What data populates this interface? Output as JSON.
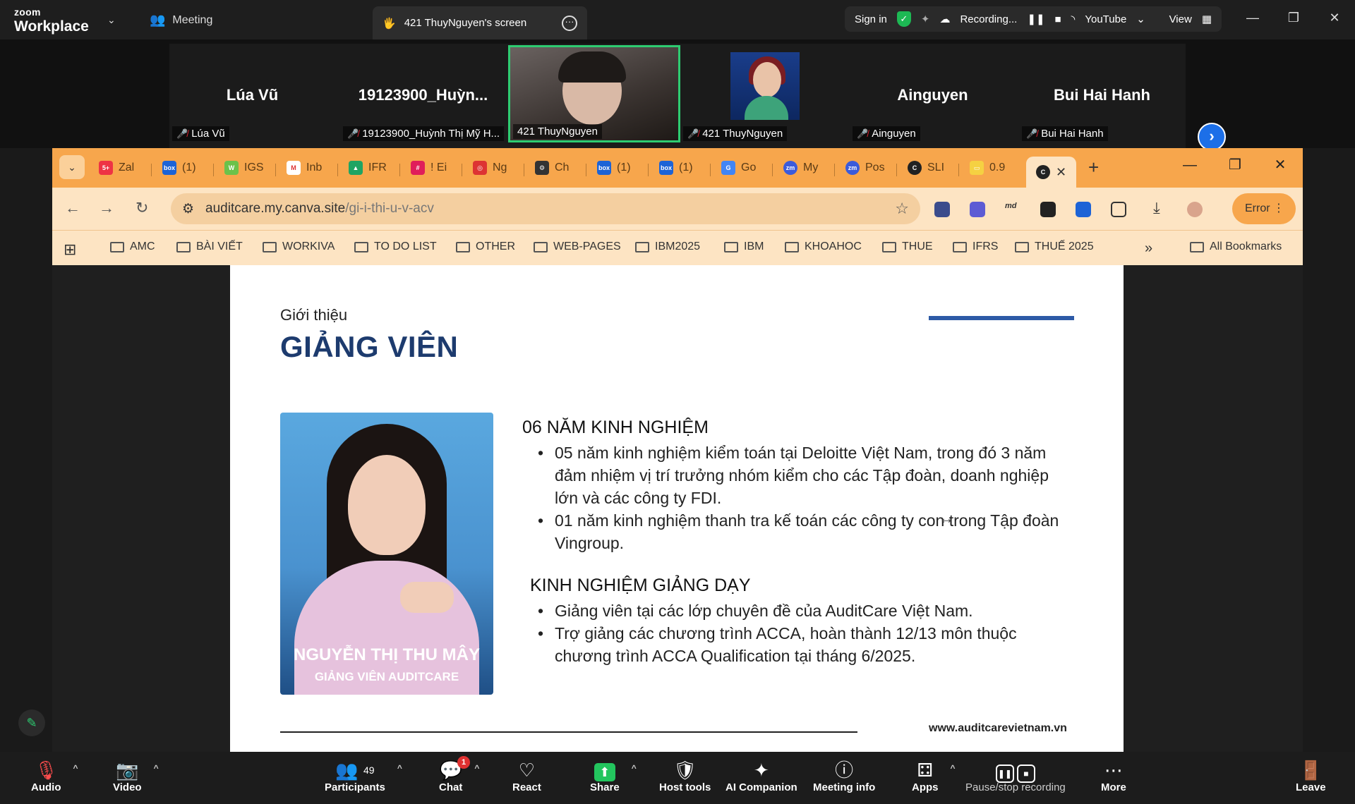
{
  "zoom": {
    "logo_small": "zoom",
    "logo_big": "Workplace",
    "meeting_label": "Meeting",
    "screen_tab_label": "421 ThuyNguyen's screen",
    "sign_in": "Sign in",
    "recording": "Recording...",
    "youtube": "YouTube",
    "view": "View"
  },
  "participants": [
    {
      "display": "Lúa Vũ",
      "caption": "Lúa Vũ"
    },
    {
      "display": "19123900_Huỳn...",
      "caption": "19123900_Huỳnh Thị Mỹ H..."
    },
    {
      "display": "",
      "caption": "421 ThuyNguyen"
    },
    {
      "display": "",
      "caption": "421 ThuyNguyen"
    },
    {
      "display": "Ainguyen",
      "caption": "Ainguyen"
    },
    {
      "display": "Bui Hai Hanh",
      "caption": "Bui Hai Hanh"
    }
  ],
  "browser": {
    "tabs": [
      "Zal",
      "(1)",
      "IGS",
      "Inb",
      "IFR",
      "! Ei",
      "Ng",
      "Ch",
      "(1)",
      "(1)",
      "Go",
      "My",
      "Pos",
      "SLI",
      "0.9"
    ],
    "url_host": "auditcare.my.canva.site",
    "url_path": "/gi-i-thi-u-v-acv",
    "error_label": "Error",
    "bookmarks": [
      "AMC",
      "BÀI VIẾT",
      "WORKIVA",
      "TO DO LIST",
      "OTHER",
      "WEB-PAGES",
      "IBM2025",
      "IBM",
      "KHOAHOC",
      "THUE",
      "IFRS",
      "THUẾ 2025"
    ],
    "all_bookmarks": "All Bookmarks"
  },
  "slide": {
    "subtitle": "Giới thiệu",
    "title": "GIẢNG VIÊN",
    "photo_name": "NGUYỄN THỊ THU MÂY",
    "photo_role": "GIẢNG VIÊN AUDITCARE",
    "exp_heading": "06 NĂM KINH NGHIỆM",
    "exp_items": [
      "05 năm kinh nghiệm kiểm toán tại Deloitte Việt Nam, trong đó 3 năm đảm nhiệm vị trí trưởng nhóm kiểm cho các Tập đoàn, doanh nghiệp lớn và các công ty FDI.",
      "01 năm kinh nghiệm thanh tra kế toán các công ty con trong Tập đoàn Vingroup."
    ],
    "teach_heading": "KINH NGHIỆM GIẢNG DẠY",
    "teach_items": [
      "Giảng viên tại các lớp chuyên đề của AuditCare Việt Nam.",
      "Trợ giảng các chương trình ACCA, hoàn thành 12/13 môn thuộc chương trình ACCA Qualification tại tháng 6/2025."
    ],
    "website": "www.auditcarevietnam.vn"
  },
  "toolbar": {
    "audio": "Audio",
    "video": "Video",
    "participants": "Participants",
    "participants_count": "49",
    "chat": "Chat",
    "chat_badge": "1",
    "react": "React",
    "share": "Share",
    "host_tools": "Host tools",
    "ai_companion": "AI Companion",
    "meeting_info": "Meeting info",
    "apps": "Apps",
    "pause_stop": "Pause/stop recording",
    "more": "More",
    "leave": "Leave"
  }
}
